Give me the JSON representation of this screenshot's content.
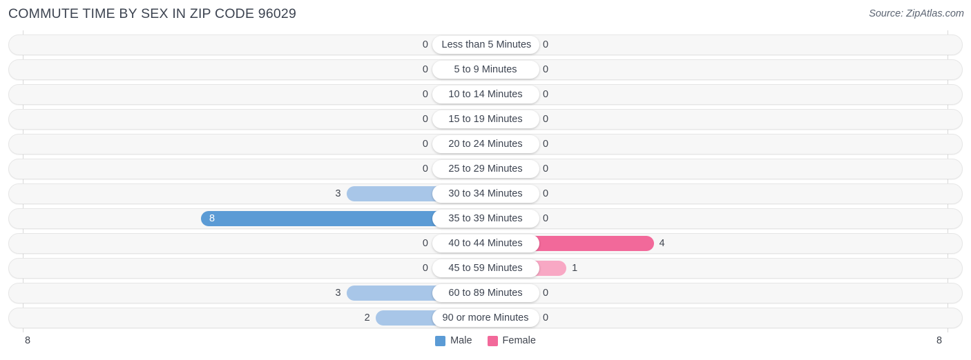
{
  "header": {
    "title": "COMMUTE TIME BY SEX IN ZIP CODE 96029",
    "source": "Source: ZipAtlas.com"
  },
  "legend": {
    "male_label": "Male",
    "female_label": "Female",
    "male_color": "#5b9bd5",
    "female_color": "#f2699a",
    "male_color_light": "#a8c6e8",
    "female_color_light": "#f8a8c4"
  },
  "axis": {
    "left_tick": "8",
    "right_tick": "8"
  },
  "chart_data": {
    "type": "bar",
    "title": "COMMUTE TIME BY SEX IN ZIP CODE 96029",
    "subtitle": "Source: ZipAtlas.com",
    "orientation": "horizontal-diverging",
    "xlabel": "",
    "ylabel": "",
    "xlim": [
      8,
      8
    ],
    "grid": false,
    "legend_position": "bottom-center",
    "categories": [
      "Less than 5 Minutes",
      "5 to 9 Minutes",
      "10 to 14 Minutes",
      "15 to 19 Minutes",
      "20 to 24 Minutes",
      "25 to 29 Minutes",
      "30 to 34 Minutes",
      "35 to 39 Minutes",
      "40 to 44 Minutes",
      "45 to 59 Minutes",
      "60 to 89 Minutes",
      "90 or more Minutes"
    ],
    "series": [
      {
        "name": "Male",
        "values": [
          0,
          0,
          0,
          0,
          0,
          0,
          3,
          8,
          0,
          0,
          3,
          2
        ]
      },
      {
        "name": "Female",
        "values": [
          0,
          0,
          0,
          0,
          0,
          0,
          0,
          0,
          4,
          1,
          0,
          0
        ]
      }
    ],
    "value_labels": {
      "male": [
        "0",
        "0",
        "0",
        "0",
        "0",
        "0",
        "3",
        "8",
        "0",
        "0",
        "3",
        "2"
      ],
      "female": [
        "0",
        "0",
        "0",
        "0",
        "0",
        "0",
        "0",
        "0",
        "4",
        "1",
        "0",
        "0"
      ]
    }
  }
}
